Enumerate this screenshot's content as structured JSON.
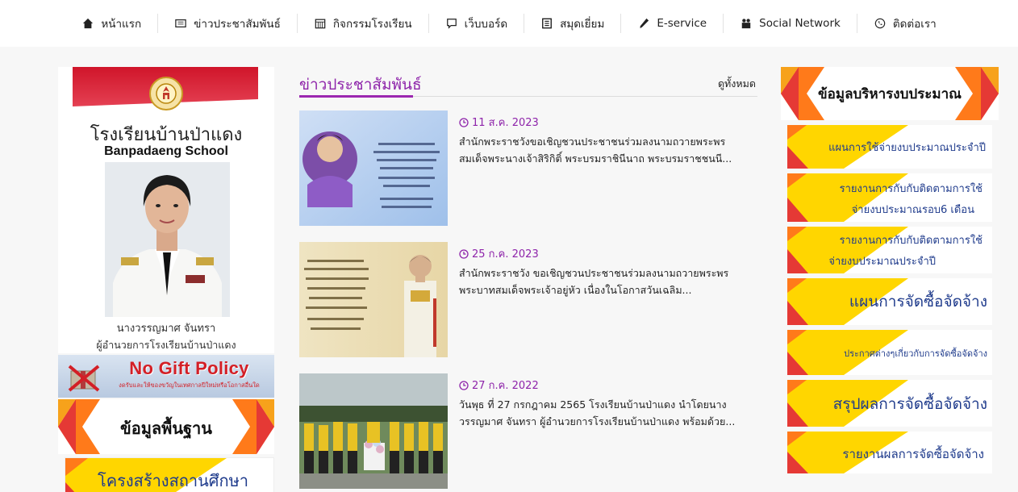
{
  "nav": [
    {
      "label": "หน้าแรก",
      "icon": "home-icon"
    },
    {
      "label": "ข่าวประชาสัมพันธ์",
      "icon": "newspaper-icon"
    },
    {
      "label": "กิจกรรมโรงเรียน",
      "icon": "calendar-icon"
    },
    {
      "label": "เว็บบอร์ด",
      "icon": "comment-icon"
    },
    {
      "label": "สมุดเยี่ยม",
      "icon": "book-icon"
    },
    {
      "label": "E-service",
      "icon": "wrench-icon"
    },
    {
      "label": "Social Network",
      "icon": "users-icon"
    },
    {
      "label": "ติดต่อเรา",
      "icon": "phone-icon"
    }
  ],
  "director": {
    "school_th": "โรงเรียนบ้านป่าแดง",
    "school_en": "Banpadaeng School",
    "name": "นางวรรญมาศ จันทรา",
    "title": "ผู้อำนวยการโรงเรียนบ้านป่าแดง"
  },
  "nogift": {
    "title": "No Gift Policy",
    "subtitle": "งดรับและให้ของขวัญในเทศกาลปีใหม่หรือโอกาสอื่นใด"
  },
  "left_banners": {
    "basic": "ข้อมูลพื้นฐาน",
    "structure": "โครงสร้างสถานศึกษา"
  },
  "news_section": {
    "title": "ข่าวประชาสัมพันธ์",
    "see_all": "ดูทั้งหมด",
    "items": [
      {
        "date": "11 ส.ค. 2023",
        "text": "สำนักพระราชวังขอเชิญชวนประชาชนร่วมลงนามถวายพระพร สมเด็จพระนางเจ้าสิริกิติ์ พระบรมราชินีนาถ พระบรมราชชนนี..."
      },
      {
        "date": "25 ก.ค. 2023",
        "text": "สำนักพระราชวัง ขอเชิญชวนประชาชนร่วมลงนามถวายพระพร พระบาทสมเด็จพระเจ้าอยู่หัว เนื่องในโอกาสวันเฉลิม..."
      },
      {
        "date": "27 ก.ค. 2022",
        "text": "วันพุธ ที่ 27 กรกฎาคม 2565 โรงเรียนบ้านป่าแดง นำโดยนาง วรรญมาศ จันทรา ผู้อำนวยการโรงเรียนบ้านป่าแดง พร้อมด้วย..."
      }
    ]
  },
  "budget": {
    "header": "ข้อมูลบริหารงบประมาณ",
    "items": [
      {
        "line1": "แผนการใช้จ่ายงบประมาณประจำปี",
        "line2": ""
      },
      {
        "line1": "รายงานการกับกับติดตามการใช้",
        "line2": "จ่ายงบประมาณรอบ6 เดือน"
      },
      {
        "line1": "รายงานการกับกับติดตามการใช้",
        "line2": "จ่ายงบประมาณประจำปี"
      },
      {
        "line1": "แผนการจัดซื้อจัดจ้าง",
        "line2": ""
      },
      {
        "line1": "ประกาศต่างๆเกี่ยวกับการจัดซื้อจัดจ้าง",
        "line2": ""
      },
      {
        "line1": "สรุปผลการจัดซื้อจัดจ้าง",
        "line2": ""
      },
      {
        "line1": "รายงานผลการจัดซื้อจัดจ้าง",
        "line2": ""
      }
    ]
  },
  "colors": {
    "accent_purple": "#8e24aa",
    "banner_yellow": "#ffd600",
    "banner_red": "#e53935",
    "banner_orange": "#ff7a1a",
    "link_blue": "#1f3b8c"
  }
}
